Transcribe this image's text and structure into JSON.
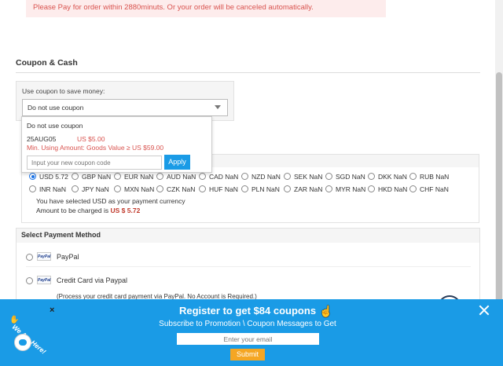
{
  "alert": {
    "text": "Please Pay for order within 2880minuts. Or your order will be canceled automatically."
  },
  "coupon": {
    "section_title": "Coupon & Cash",
    "label": "Use coupon to save money:",
    "selected": "Do not use coupon",
    "dropdown": {
      "option_none": "Do not use coupon",
      "code": "25AUG05",
      "value": "US $5.00",
      "min": "Min. Using Amount: Goods Value ≥ US $59.00",
      "input_placeholder": "Input your new coupon code",
      "apply_label": "Apply"
    }
  },
  "currency": {
    "row1": [
      "USD 5.72",
      "GBP NaN",
      "EUR NaN",
      "AUD NaN",
      "CAD NaN",
      "NZD NaN",
      "SEK NaN",
      "SGD NaN",
      "DKK NaN",
      "RUB NaN"
    ],
    "row2": [
      "INR NaN",
      "JPY NaN",
      "MXN NaN",
      "CZK NaN",
      "HUF NaN",
      "PLN NaN",
      "ZAR NaN",
      "MYR NaN",
      "HKD NaN",
      "CHF NaN"
    ],
    "selected": "USD 5.72",
    "note": "You have selected USD as your payment currency",
    "amount_prefix": "Amount to be charged is",
    "amount_value": "US $ 5.72"
  },
  "payment": {
    "header": "Select Payment Method",
    "logo_text": "PayPal",
    "methods": [
      "PayPal",
      "Credit Card via Paypal"
    ],
    "note": "(Process your credit card payment via PayPal. No Account is Required.)"
  },
  "banner": {
    "title": "Register to get $84 coupons",
    "subtitle": "Subscribe to Promotion \\ Coupon Messages to Get",
    "email_placeholder": "Enter your email",
    "submit_label": "Submit",
    "close_glyph": "×"
  },
  "chat": {
    "tag": "We Are Here!",
    "close_glyph": "×"
  },
  "colors": {
    "accent": "#1a9be6",
    "alert_bg": "#fdecec",
    "alert_text": "#d9534f",
    "submit": "#f5a623"
  }
}
